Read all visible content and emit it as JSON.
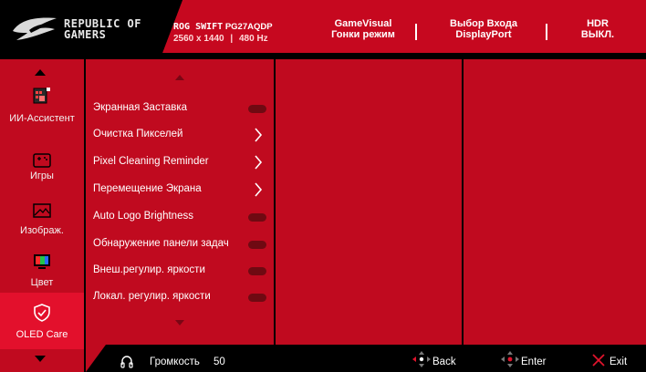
{
  "header": {
    "brand_line1": "REPUBLIC OF",
    "brand_line2": "GAMERS",
    "model_prefix": "ROG SWIFT",
    "model_name": "PG27AQDP",
    "resolution": "2560 x 1440",
    "refresh_separator": "|",
    "refresh": "480 Hz",
    "status": [
      {
        "line1": "GameVisual",
        "line2": "Гонки режим"
      },
      {
        "line1": "Выбор Входа",
        "line2": "DisplayPort"
      },
      {
        "line1": "HDR",
        "line2": "ВЫКЛ."
      }
    ]
  },
  "nav": {
    "items": [
      {
        "label": "ИИ-Ассистент",
        "icon": "ai-assistant-icon"
      },
      {
        "label": "Игры",
        "icon": "gamepad-icon"
      },
      {
        "label": "Изображ.",
        "icon": "image-icon"
      },
      {
        "label": "Цвет",
        "icon": "color-icon"
      },
      {
        "label": "OLED Care",
        "icon": "shield-check-icon",
        "active": true
      }
    ]
  },
  "menu": {
    "items": [
      {
        "label": "Экранная Заставка",
        "control": "toggle",
        "state": "off"
      },
      {
        "label": "Очистка Пикселей",
        "control": "submenu"
      },
      {
        "label": "Pixel Cleaning Reminder",
        "control": "submenu"
      },
      {
        "label": "Перемещение Экрана",
        "control": "submenu"
      },
      {
        "label": "Auto Logo Brightness",
        "control": "toggle",
        "state": "off"
      },
      {
        "label": "Обнаружение панели задач",
        "control": "toggle",
        "state": "off"
      },
      {
        "label": "Внеш.регулир. яркости",
        "control": "toggle",
        "state": "off"
      },
      {
        "label": "Локал. регулир. яркости",
        "control": "toggle",
        "state": "off"
      }
    ]
  },
  "footer": {
    "volume_label": "Громкость",
    "volume_value": "50",
    "back_label": "Back",
    "enter_label": "Enter",
    "exit_label": "Exit"
  },
  "colors": {
    "accent_red": "#c00a1f",
    "header_red": "#c6081f",
    "active_red": "#e3102c",
    "background": "#000000",
    "toggle_off": "#6f0a12"
  }
}
